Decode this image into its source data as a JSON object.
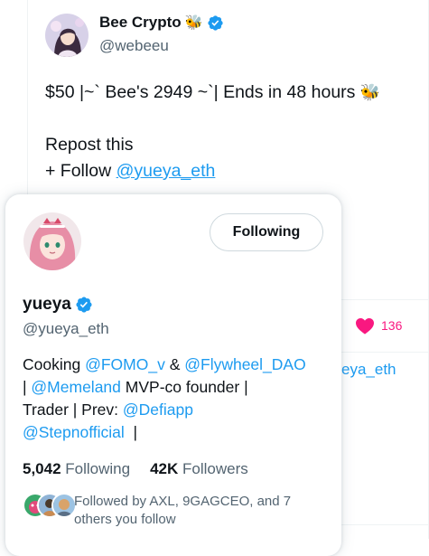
{
  "tweet": {
    "author_name": "Bee Crypto",
    "author_emoji": "🐝",
    "author_handle": "@webeeu",
    "line1": "$50 |~` Bee's 2949 ~`| Ends in 48 hours",
    "line1_emoji": "🐝",
    "line2": "Repost this",
    "line3_prefix": "+ Follow ",
    "line3_mention": "@yueya_eth",
    "like_count": "136",
    "behind_text": "eya_eth"
  },
  "hover_card": {
    "name": "yueya",
    "handle": "@yueya_eth",
    "follow_button": "Following",
    "bio": {
      "l1_a": "Cooking ",
      "l1_m1": "@FOMO_v",
      "l1_b": " & ",
      "l1_m2": "@Flywheel_DAO",
      "l2_a": " | ",
      "l2_m1": "@Memeland",
      "l2_b": " MVP-co founder |",
      "l3_a": "Trader | Prev: ",
      "l3_m1": "@Defiapp",
      "l4_m1": "@Stepnofficial",
      "l4_b": "  |"
    },
    "stats": {
      "following_count": "5,042",
      "following_label": "Following",
      "followers_count": "42K",
      "followers_label": "Followers"
    },
    "followed_by_line1": "Followed by AXL, 9GAGCEO, and 7",
    "followed_by_line2": "others you follow"
  },
  "colors": {
    "accent": "#1d9bf0",
    "like": "#f91880",
    "verified": "#1d9bf0",
    "text_secondary": "#536471"
  },
  "icons": {
    "verified": "verified-badge-icon",
    "like": "heart-icon"
  }
}
